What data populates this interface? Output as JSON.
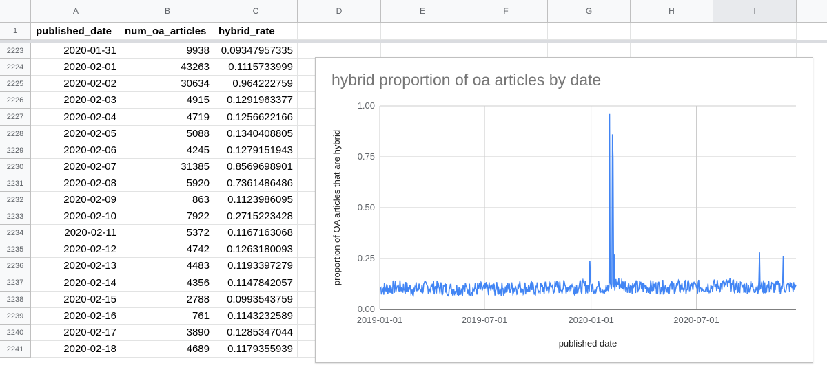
{
  "sheet": {
    "columns": [
      "A",
      "B",
      "C",
      "D",
      "E",
      "F",
      "G",
      "H",
      "I"
    ],
    "selected_column": "I",
    "header_row": {
      "row_number": "1",
      "cells": [
        "published_date",
        "num_oa_articles",
        "hybrid_rate"
      ]
    },
    "rows": [
      {
        "n": "2223",
        "date": "2020-01-31",
        "num": "9938",
        "rate": "0.09347957335"
      },
      {
        "n": "2224",
        "date": "2020-02-01",
        "num": "43263",
        "rate": "0.1115733999"
      },
      {
        "n": "2225",
        "date": "2020-02-02",
        "num": "30634",
        "rate": "0.964222759"
      },
      {
        "n": "2226",
        "date": "2020-02-03",
        "num": "4915",
        "rate": "0.1291963377"
      },
      {
        "n": "2227",
        "date": "2020-02-04",
        "num": "4719",
        "rate": "0.1256622166"
      },
      {
        "n": "2228",
        "date": "2020-02-05",
        "num": "5088",
        "rate": "0.1340408805"
      },
      {
        "n": "2229",
        "date": "2020-02-06",
        "num": "4245",
        "rate": "0.1279151943"
      },
      {
        "n": "2230",
        "date": "2020-02-07",
        "num": "31385",
        "rate": "0.8569698901"
      },
      {
        "n": "2231",
        "date": "2020-02-08",
        "num": "5920",
        "rate": "0.7361486486"
      },
      {
        "n": "2232",
        "date": "2020-02-09",
        "num": "863",
        "rate": "0.1123986095"
      },
      {
        "n": "2233",
        "date": "2020-02-10",
        "num": "7922",
        "rate": "0.2715223428"
      },
      {
        "n": "2234",
        "date": "2020-02-11",
        "num": "5372",
        "rate": "0.1167163068"
      },
      {
        "n": "2235",
        "date": "2020-02-12",
        "num": "4742",
        "rate": "0.1263180093"
      },
      {
        "n": "2236",
        "date": "2020-02-13",
        "num": "4483",
        "rate": "0.1193397279"
      },
      {
        "n": "2237",
        "date": "2020-02-14",
        "num": "4356",
        "rate": "0.1147842057"
      },
      {
        "n": "2238",
        "date": "2020-02-15",
        "num": "2788",
        "rate": "0.0993543759"
      },
      {
        "n": "2239",
        "date": "2020-02-16",
        "num": "761",
        "rate": "0.1143232589"
      },
      {
        "n": "2240",
        "date": "2020-02-17",
        "num": "3890",
        "rate": "0.1285347044"
      },
      {
        "n": "2241",
        "date": "2020-02-18",
        "num": "4689",
        "rate": "0.1179355939"
      }
    ]
  },
  "chart_data": {
    "type": "line",
    "title": "hybrid proportion of oa articles by date",
    "xlabel": "published date",
    "ylabel": "proportion of OA articles that are hybrid",
    "xlim": [
      "2019-01-01",
      "2020-12-20"
    ],
    "ylim": [
      0,
      1
    ],
    "x_ticks": [
      "2019-01-01",
      "2019-07-01",
      "2020-01-01",
      "2020-07-01"
    ],
    "y_ticks": [
      "0.00",
      "0.25",
      "0.50",
      "0.75",
      "1.00"
    ],
    "grid": true,
    "series_color": "#4285f4",
    "series": [
      {
        "points": [
          [
            "2019-01-01",
            0.1
          ],
          [
            "2019-02-01",
            0.11
          ],
          [
            "2019-03-01",
            0.1
          ],
          [
            "2019-04-01",
            0.11
          ],
          [
            "2019-05-01",
            0.1
          ],
          [
            "2019-06-01",
            0.1
          ],
          [
            "2019-07-01",
            0.1
          ],
          [
            "2019-08-01",
            0.1
          ],
          [
            "2019-09-01",
            0.11
          ],
          [
            "2019-10-01",
            0.1
          ],
          [
            "2019-11-01",
            0.11
          ],
          [
            "2019-12-01",
            0.11
          ],
          [
            "2019-12-30",
            0.24
          ],
          [
            "2020-01-15",
            0.12
          ],
          [
            "2020-01-31",
            0.09
          ],
          [
            "2020-02-01",
            0.11
          ],
          [
            "2020-02-02",
            0.96
          ],
          [
            "2020-02-03",
            0.13
          ],
          [
            "2020-02-07",
            0.86
          ],
          [
            "2020-02-08",
            0.74
          ],
          [
            "2020-02-10",
            0.27
          ],
          [
            "2020-02-12",
            0.13
          ],
          [
            "2020-03-15",
            0.11
          ],
          [
            "2020-05-01",
            0.11
          ],
          [
            "2020-07-01",
            0.11
          ],
          [
            "2020-09-01",
            0.12
          ],
          [
            "2020-10-18",
            0.28
          ],
          [
            "2020-11-15",
            0.13
          ],
          [
            "2020-11-28",
            0.26
          ],
          [
            "2020-12-20",
            0.12
          ]
        ]
      }
    ]
  }
}
